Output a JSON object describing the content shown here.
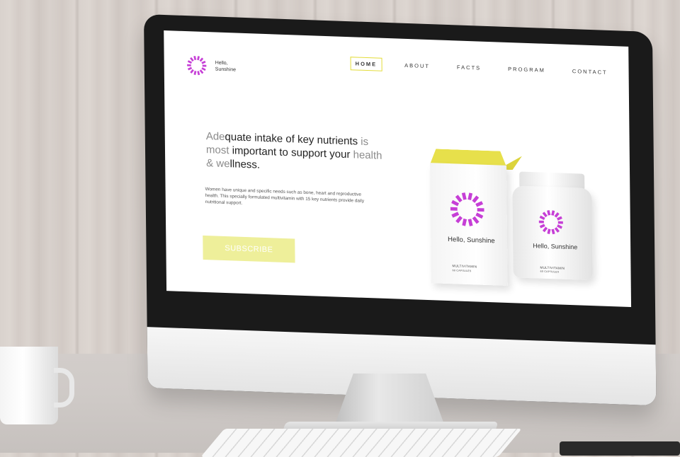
{
  "logo": {
    "text": "Hello, Sunshine"
  },
  "nav": {
    "items": [
      {
        "label": "HOME",
        "active": true
      },
      {
        "label": "ABOUT",
        "active": false
      },
      {
        "label": "FACTS",
        "active": false
      },
      {
        "label": "PROGRAM",
        "active": false
      },
      {
        "label": "CONTACT",
        "active": false
      }
    ]
  },
  "hero": {
    "headline_part1": "Ade",
    "headline_part2": "quate intake of key nutrients ",
    "headline_part3": "is most ",
    "headline_part4": "important to support your ",
    "headline_part5": "health & we",
    "headline_part6": "llness.",
    "body": "Women have unique and specific needs such as bone, heart and reproductive health. This specially formulated multivitamin with 15 key nutrients provide daily nutritional support.",
    "cta_label": "SUBSCRIBE"
  },
  "product": {
    "box_name": "Hello, Sunshine",
    "box_type": "MULTIVITAMIN",
    "box_count": "60 CAPSULES",
    "bottle_name": "Hello, Sunshine",
    "bottle_type": "MULTIVITAMIN",
    "bottle_count": "60 CAPSULES"
  },
  "colors": {
    "accent_yellow": "#e7e04b",
    "cta_yellow": "#eeef9a",
    "brand_magenta": "#c63fd6"
  },
  "icons": {
    "logo_icon": "sunburst-ring-icon"
  }
}
